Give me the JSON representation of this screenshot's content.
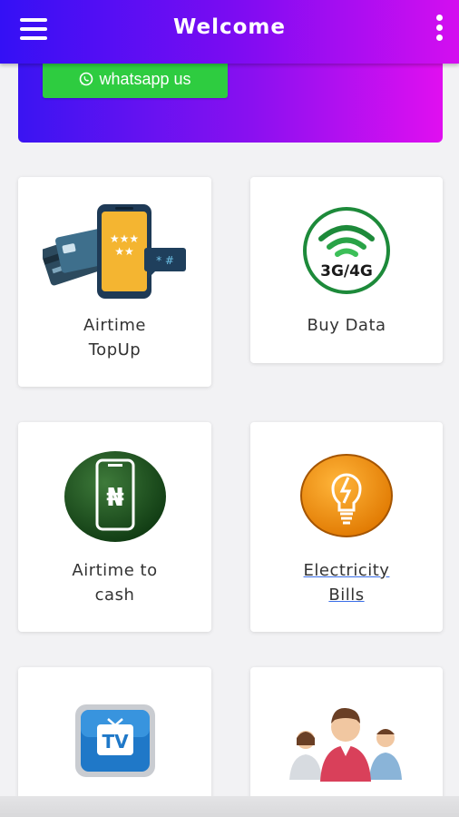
{
  "header": {
    "title": "Welcome"
  },
  "banner": {
    "whatsapp_label": "whatsapp us"
  },
  "services": [
    {
      "line1": "Airtime",
      "line2": "TopUp"
    },
    {
      "line1": "Buy Data",
      "line2": ""
    },
    {
      "line1": "Airtime to",
      "line2": "cash"
    },
    {
      "line1": "Electricity",
      "line2": "Bills"
    },
    {
      "line1": "",
      "line2": ""
    },
    {
      "line1": "",
      "line2": ""
    }
  ],
  "icons": {
    "data": "3G/4G",
    "currency": "₦",
    "tv": "TV"
  },
  "colors": {
    "header_gradient": [
      "#3410f5",
      "#d40ef0"
    ],
    "whatsapp_green": "#2ecc40"
  }
}
